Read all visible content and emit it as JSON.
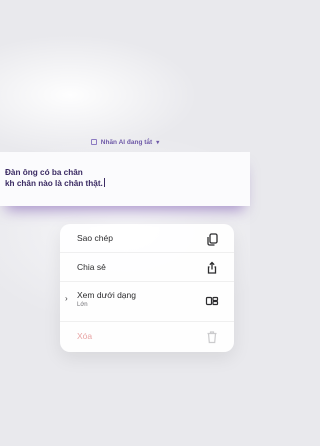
{
  "ai_bar": {
    "label": "Nhãn AI đang tắt",
    "checkbox_icon": "checkbox-icon",
    "chevron_icon": "chevron-down-icon"
  },
  "note": {
    "line1": "Đàn ông có ba chân",
    "line2": "kh chân nào là chân thật."
  },
  "menu": {
    "copy_label": "Sao chép",
    "copy_icon": "copy-icon",
    "share_label": "Chia sẻ",
    "share_icon": "share-icon",
    "view_label": "Xem dưới dạng",
    "view_sub": "Lớn",
    "view_arrow": "›",
    "view_icon": "layout-icon",
    "delete_label": "Xóa",
    "delete_icon": "trash-icon"
  },
  "colors": {
    "accent": "#6f5aa8",
    "note_text": "#3b2b63",
    "delete_text": "#e8a3a3"
  }
}
